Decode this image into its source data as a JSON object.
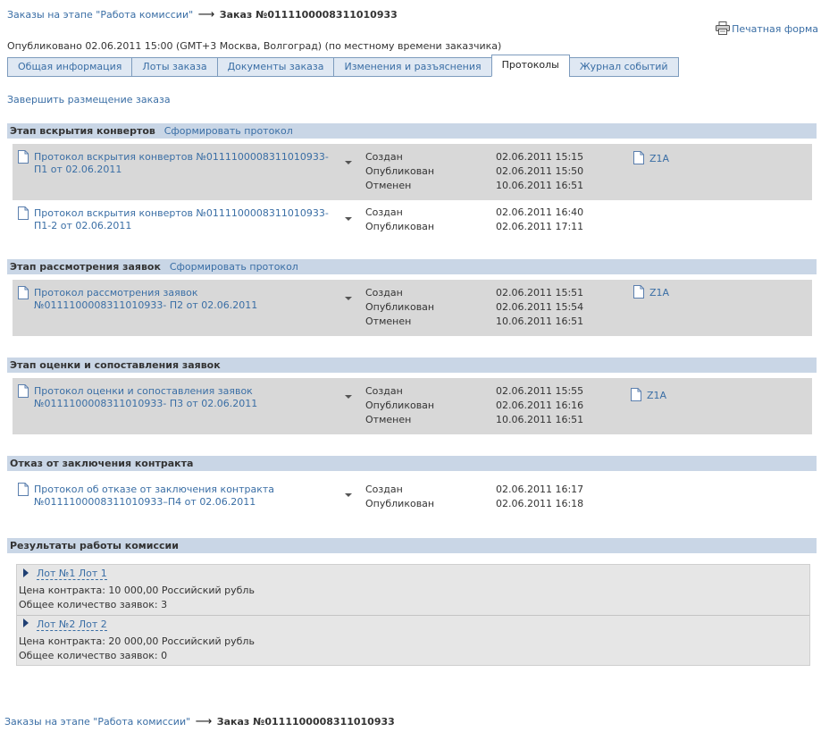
{
  "breadcrumb": {
    "link": "Заказы на этапе \"Работа комиссии\"",
    "arrow": "⟶",
    "current": "Заказ №0111100008311010933"
  },
  "print_label": "Печатная форма",
  "published": "Опубликовано 02.06.2011 15:00 (GMT+3 Москва, Волгоград) (по местному времени заказчика)",
  "tabs": [
    {
      "label": "Общая информация",
      "active": false
    },
    {
      "label": "Лоты заказа",
      "active": false
    },
    {
      "label": "Документы заказа",
      "active": false
    },
    {
      "label": "Изменения и разъяснения",
      "active": false
    },
    {
      "label": "Протоколы",
      "active": true
    },
    {
      "label": "Журнал событий",
      "active": false
    }
  ],
  "finish_link": "Завершить размещение заказа",
  "sections": [
    {
      "title": "Этап вскрытия конвертов",
      "action": "Сформировать протокол",
      "rows": [
        {
          "title": "Протокол вскрытия конвертов №0111100008311010933-П1 от 02.06.2011",
          "statuses": [
            "Создан",
            "Опубликован",
            "Отменен"
          ],
          "dates": [
            "02.06.2011 15:15",
            "02.06.2011 15:50",
            "10.06.2011 16:51"
          ],
          "attachment": "Z1A"
        },
        {
          "title": "Протокол вскрытия конвертов №0111100008311010933-П1-2 от 02.06.2011",
          "statuses": [
            "Создан",
            "Опубликован"
          ],
          "dates": [
            "02.06.2011 16:40",
            "02.06.2011 17:11"
          ],
          "attachment": ""
        }
      ]
    },
    {
      "title": "Этап рассмотрения заявок",
      "action": "Сформировать протокол",
      "rows": [
        {
          "title": "Протокол рассмотрения заявок №0111100008311010933- П2 от 02.06.2011",
          "statuses": [
            "Создан",
            "Опубликован",
            "Отменен"
          ],
          "dates": [
            "02.06.2011 15:51",
            "02.06.2011 15:54",
            "10.06.2011 16:51"
          ],
          "attachment": "Z1A"
        }
      ]
    },
    {
      "title": "Этап оценки и сопоставления заявок",
      "action": "",
      "rows": [
        {
          "title": "Протокол оценки и сопоставления заявок №0111100008311010933- П3 от 02.06.2011",
          "statuses": [
            "Создан",
            "Опубликован",
            "Отменен"
          ],
          "dates": [
            "02.06.2011 15:55",
            "02.06.2011 16:16",
            "10.06.2011 16:51"
          ],
          "attachment": "Z1A"
        }
      ]
    },
    {
      "title": "Отказ от заключения контракта",
      "action": "",
      "rows": [
        {
          "title": "Протокол об отказе от заключения контракта №0111100008311010933–П4 от 02.06.2011",
          "statuses": [
            "Создан",
            "Опубликован"
          ],
          "dates": [
            "02.06.2011 16:17",
            "02.06.2011 16:18"
          ],
          "attachment": ""
        }
      ]
    }
  ],
  "results": {
    "title": "Результаты работы комиссии",
    "lots": [
      {
        "label": "Лот №1 Лот 1",
        "price": "Цена контракта: 10 000,00  Российский рубль",
        "count": "Общее количество заявок: 3"
      },
      {
        "label": "Лот №2 Лот 2",
        "price": "Цена контракта: 20 000,00  Российский рубль",
        "count": "Общее количество заявок: 0"
      }
    ]
  }
}
